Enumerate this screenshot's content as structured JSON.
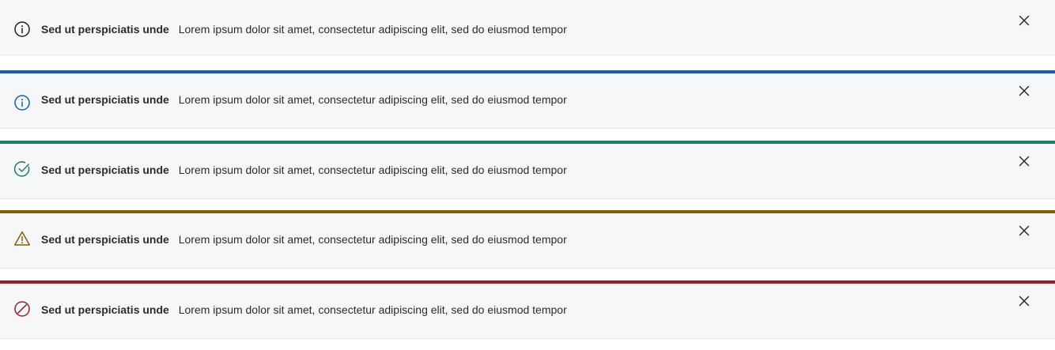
{
  "banners": [
    {
      "variant": "neutral",
      "accent_color": "#1f1f1f",
      "icon": "info-icon",
      "title": "Sed ut perspiciatis unde",
      "message": "Lorem ipsum dolor sit amet, consectetur adipiscing elit, sed do eiusmod tempor",
      "close_icon": "close-icon"
    },
    {
      "variant": "info",
      "accent_color": "#0f5fc2",
      "icon": "info-icon",
      "title": "Sed ut perspiciatis unde",
      "message": "Lorem ipsum dolor sit amet, consectetur adipiscing elit, sed do eiusmod tempor",
      "close_icon": "close-icon"
    },
    {
      "variant": "success",
      "accent_color": "#1d8060",
      "icon": "check-circle-icon",
      "title": "Sed ut perspiciatis unde",
      "message": "Lorem ipsum dolor sit amet, consectetur adipiscing elit, sed do eiusmod tempor",
      "close_icon": "close-icon"
    },
    {
      "variant": "warning",
      "accent_color": "#8a5d00",
      "icon": "warning-triangle-icon",
      "title": "Sed ut perspiciatis unde",
      "message": "Lorem ipsum dolor sit amet, consectetur adipiscing elit, sed do eiusmod tempor",
      "close_icon": "close-icon"
    },
    {
      "variant": "error",
      "accent_color": "#9b1c2a",
      "icon": "blocked-icon",
      "title": "Sed ut perspiciatis unde",
      "message": "Lorem ipsum dolor sit amet, consectetur adipiscing elit, sed do eiusmod tempor",
      "close_icon": "close-icon"
    }
  ]
}
